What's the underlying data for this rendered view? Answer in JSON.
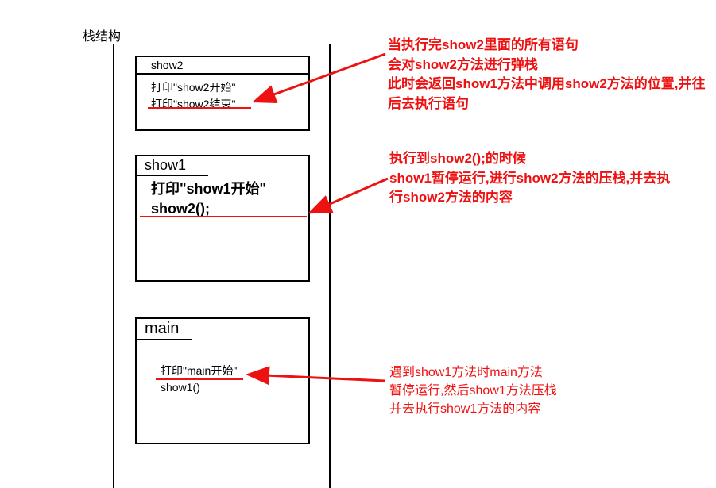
{
  "title": "栈结构",
  "frames": {
    "show2": {
      "name": "show2",
      "lines": [
        "打印\"show2开始\"",
        "打印\"show2结束\""
      ]
    },
    "show1": {
      "name": "show1",
      "lines": [
        "打印\"show1开始\"",
        "show2();"
      ]
    },
    "main": {
      "name": "main",
      "lines": [
        "打印\"main开始\"",
        "show1()"
      ]
    }
  },
  "annotations": {
    "a1": "当执行完show2里面的所有语句\n会对show2方法进行弹栈\n此时会返回show1方法中调用show2方法的位置,并往后去执行语句",
    "a2": "执行到show2();的时候\nshow1暂停运行,进行show2方法的压栈,并去执行show2方法的内容",
    "a3": "遇到show1方法时main方法\n暂停运行,然后show1方法压栈\n并去执行show1方法的内容"
  },
  "colors": {
    "accent": "#ee1111"
  }
}
